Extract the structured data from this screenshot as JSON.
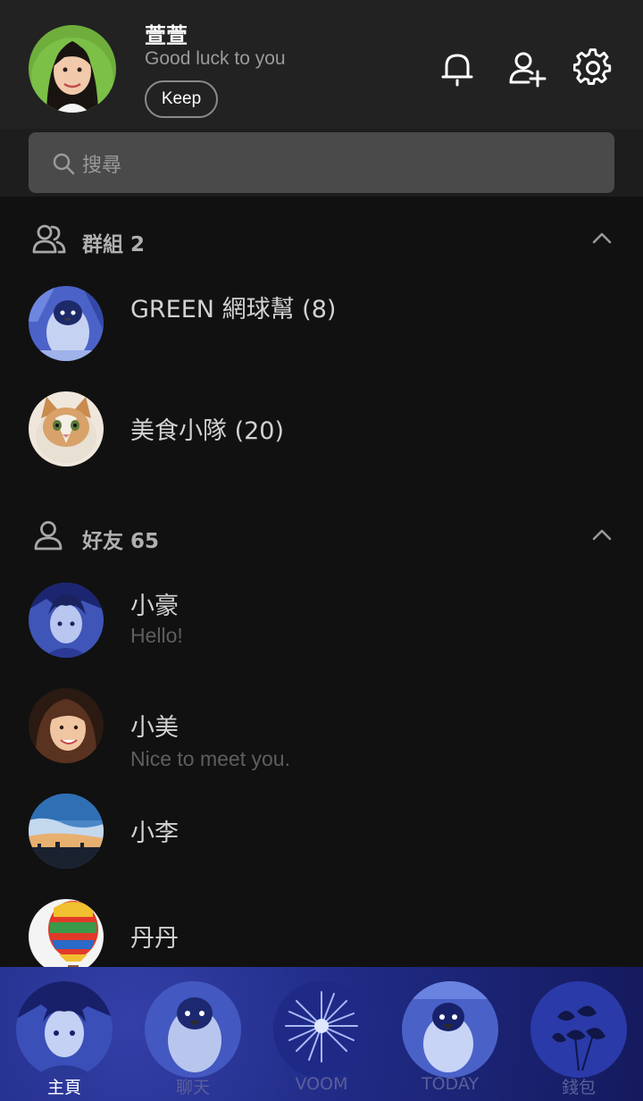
{
  "profile": {
    "name": "萱萱",
    "status": "Good luck to you",
    "keep_label": "Keep"
  },
  "header_icons": [
    "bell-icon",
    "add-friend-icon",
    "gear-icon"
  ],
  "search": {
    "placeholder": "搜尋",
    "icon": "search-icon"
  },
  "groups": {
    "title": "群組 2",
    "icon": "group-icon",
    "items": [
      {
        "name": "GREEN 網球幫 (8)"
      },
      {
        "name": "美食小隊 (20)"
      }
    ]
  },
  "friends": {
    "title": "好友 65",
    "icon": "person-icon",
    "items": [
      {
        "name": "小豪",
        "status": "Hello!"
      },
      {
        "name": "小美",
        "status": "Nice to meet you."
      },
      {
        "name": "小李",
        "status": ""
      },
      {
        "name": "丹丹",
        "status": ""
      }
    ]
  },
  "nav": {
    "active": "主頁",
    "items": [
      {
        "label": "主頁"
      },
      {
        "label": "聊天"
      },
      {
        "label": "VOOM"
      },
      {
        "label": "TODAY"
      },
      {
        "label": "錢包"
      }
    ]
  },
  "colors": {
    "background": "#111111",
    "header": "#222222",
    "search_box": "#4a4a4a",
    "nav_theme": "#1f2a84"
  }
}
